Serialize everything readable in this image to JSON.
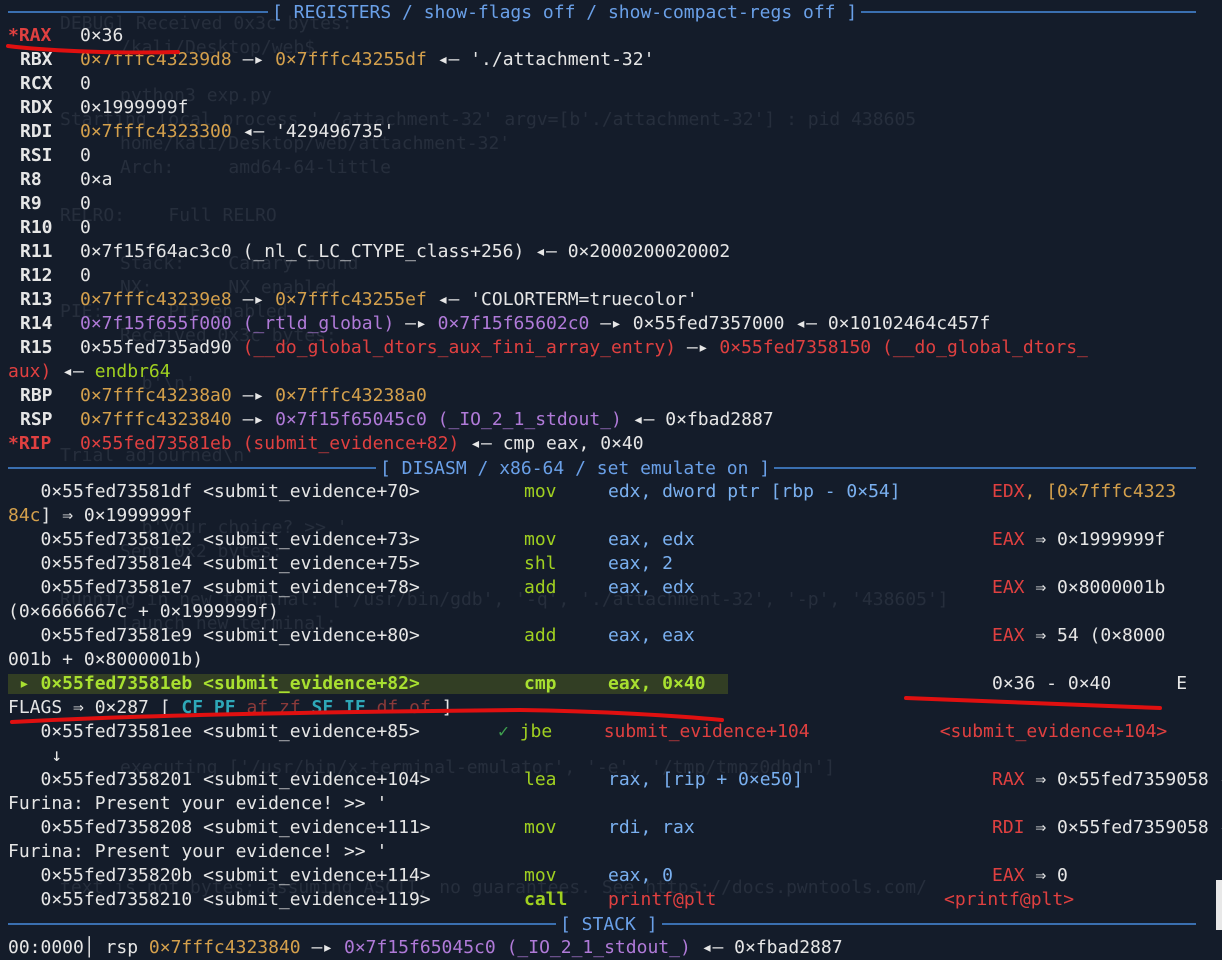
{
  "banners": {
    "registers": "[ REGISTERS / show-flags off / show-compact-regs off ]",
    "disasm": "[ DISASM / x86-64 / set emulate on ]",
    "stack": "[ STACK ]"
  },
  "registers": [
    {
      "name": "*RAX",
      "changed": true,
      "rest": "0×36"
    },
    {
      "name": "RBX",
      "changed": false,
      "rest": "0×7fffc43239d8 —▸ 0×7fffc43255df ◂— './attachment-32'"
    },
    {
      "name": "RCX",
      "changed": false,
      "rest": "0"
    },
    {
      "name": "RDX",
      "changed": false,
      "rest": "0×1999999f"
    },
    {
      "name": "RDI",
      "changed": false,
      "rest": "0×7fffc4323300 ◂— '429496735'"
    },
    {
      "name": "RSI",
      "changed": false,
      "rest": "0"
    },
    {
      "name": "R8",
      "changed": false,
      "rest": "0×a"
    },
    {
      "name": "R9",
      "changed": false,
      "rest": "0"
    },
    {
      "name": "R10",
      "changed": false,
      "rest": "0"
    },
    {
      "name": "R11",
      "changed": false,
      "rest": "0×7f15f64ac3c0 (_nl_C_LC_CTYPE_class+256) ◂— 0×2000200020002"
    },
    {
      "name": "R12",
      "changed": false,
      "rest": "0"
    },
    {
      "name": "R13",
      "changed": false,
      "rest": "0×7fffc43239e8 —▸ 0×7fffc43255ef ◂— 'COLORTERM=truecolor'"
    },
    {
      "name": "R14",
      "changed": false,
      "rest": "0×7f15f655f000 (_rtld_global) —▸ 0×7f15f65602c0 —▸ 0×55fed7357000 ◂— 0×10102464c457f"
    },
    {
      "name": "R15",
      "changed": false,
      "rest": "0×55fed735ad90 (__do_global_dtors_aux_fini_array_entry) —▸ 0×55fed7358150 (__do_global_dtors_"
    },
    {
      "name": "RBP",
      "changed": false,
      "rest": "0×7fffc43238a0 —▸ 0×7fffc43238a0"
    },
    {
      "name": "RSP",
      "changed": false,
      "rest": "0×7fffc4323840 —▸ 0×7f15f65045c0 (_IO_2_1_stdout_) ◂— 0×fbad2887"
    },
    {
      "name": "*RIP",
      "changed": true,
      "rest": "0×55fed73581eb (submit_evidence+82) ◂— cmp eax, 0×40"
    }
  ],
  "r15_wrap": "aux) ◂— endbr64",
  "disasm": [
    {
      "addr": "0×55fed73581df <submit_evidence+70>",
      "mn": "mov",
      "ops": "edx, dword ptr [rbp - 0×54]",
      "note": "EDX, [0×7fffc4323",
      "wrap": "84c] ⇒ 0×1999999f"
    },
    {
      "addr": "0×55fed73581e2 <submit_evidence+73>",
      "mn": "mov",
      "ops": "eax, edx",
      "note": "EAX ⇒ 0×1999999f"
    },
    {
      "addr": "0×55fed73581e4 <submit_evidence+75>",
      "mn": "shl",
      "ops": "eax, 2",
      "note": ""
    },
    {
      "addr": "0×55fed73581e7 <submit_evidence+78>",
      "mn": "add",
      "ops": "eax, edx",
      "note": "EAX ⇒ 0×8000001b",
      "wrap": "(0×6666667c + 0×1999999f)"
    },
    {
      "addr": "0×55fed73581e9 <submit_evidence+80>",
      "mn": "add",
      "ops": "eax, eax",
      "note": "EAX ⇒ 54 (0×8000",
      "wrap": "001b + 0×8000001b)"
    },
    {
      "addr": "0×55fed73581eb <submit_evidence+82>",
      "mn": "cmp",
      "ops": "eax, 0×40",
      "note": "0×36 - 0×40      E",
      "current": true
    },
    {
      "addr": "0×55fed73581ee <submit_evidence+85>",
      "mn": "jbe",
      "ops": "submit_evidence+104",
      "note": "<submit_evidence+104>"
    },
    {
      "addr": "0×55fed7358201 <submit_evidence+104>",
      "mn": "lea",
      "ops": "rax, [rip + 0×e50]",
      "note": "RAX ⇒ 0×55fed7359058 ◂— '",
      "wrap": "Furina: Present your evidence! >> '"
    },
    {
      "addr": "0×55fed7358208 <submit_evidence+111>",
      "mn": "mov",
      "ops": "rdi, rax",
      "note": "RDI ⇒ 0×55fed7359058 ◂— '",
      "wrap": "Furina: Present your evidence! >> '"
    },
    {
      "addr": "0×55fed735820b <submit_evidence+114>",
      "mn": "mov",
      "ops": "eax, 0",
      "note": "EAX ⇒ 0"
    },
    {
      "addr": "0×55fed7358210 <submit_evidence+119>",
      "mn": "call",
      "ops": "printf@plt",
      "note": "<printf@plt>"
    }
  ],
  "flags_line": {
    "prefix": "FLAGS ⇒ 0×287 [ ",
    "flags": [
      [
        "CF",
        true
      ],
      [
        "PF",
        true
      ],
      [
        "af",
        false
      ],
      [
        "zf",
        false
      ],
      [
        "SF",
        true
      ],
      [
        "IF",
        true
      ],
      [
        "df",
        false
      ],
      [
        "of",
        false
      ]
    ],
    "suffix": " ]"
  },
  "jbe_arrow": "↓",
  "stack_line": "00:0000│ rsp 0×7fffc4323840 —▸ 0×7f15f65045c0 (_IO_2_1_stdout_) ◂— 0×fbad2887",
  "ghost_lines": [
    "DEBUG] Received 0x3c bytes:",
    "/kali/Desktop/web$",
    "python3 exp.py",
    "Starting local process './attachment-32' argv=[b'./attachment-32'] : pid 438605",
    "home/kali/Desktop/web/attachment-32'",
    "Arch:     amd64-64-little",
    "RELRO:    Full RELRO",
    "Stack:    Canary found",
    "NX:       NX enabled",
    "PIE:      PIE enabled",
    "Received 0x3c bytes:",
    "  b'\\n'",
    "Trial adjourned\\n'",
    "  b'your choice? >> '",
    "Sent 0x2 bytes:",
    "Running in new terminal: ['/usr/bin/gdb', '-q', './attachment-32', '-p', '438605']",
    "launch new terminal:",
    "executing ['/usr/bin/x-terminal-emulator', '-e', '/tmp/tmpz0dhdn']",
    "text is not bytes; assuming ASCII, no guarantees. See https://docs.pwntools.com/"
  ]
}
